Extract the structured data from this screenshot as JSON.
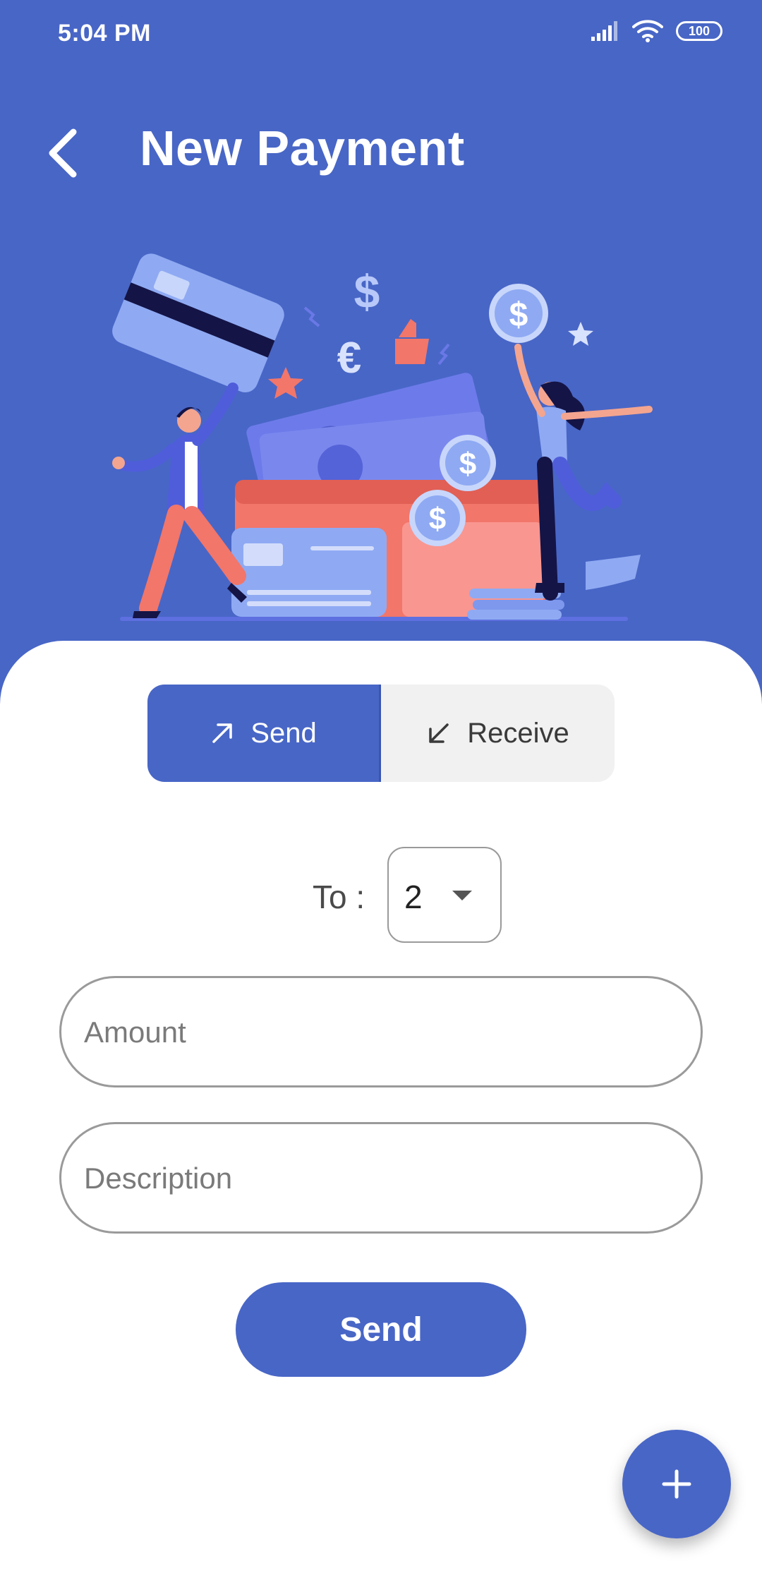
{
  "status_bar": {
    "time": "5:04 PM",
    "battery_level": "100"
  },
  "header": {
    "title": "New Payment"
  },
  "toggle": {
    "send_label": "Send",
    "receive_label": "Receive",
    "selected": "send"
  },
  "form": {
    "to_label": "To :",
    "to_value": "2",
    "amount_placeholder": "Amount",
    "description_placeholder": "Description",
    "submit_label": "Send"
  },
  "fab": {
    "icon": "plus-icon"
  },
  "colors": {
    "primary": "#4866C6",
    "sheet_bg": "#FFFFFF",
    "toggle_inactive": "#F1F1F1",
    "coral": "#F2766A",
    "light_blue": "#8FAAF3"
  }
}
